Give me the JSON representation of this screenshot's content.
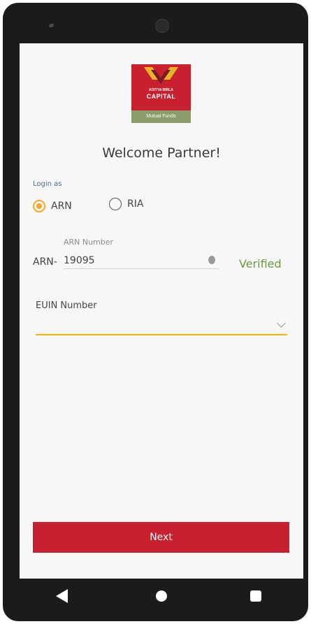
{
  "logo": {
    "line1": "ADITYA BIRLA",
    "line2": "CAPITAL",
    "sub": "Mutual Funds"
  },
  "header": {
    "title": "Welcome Partner!"
  },
  "login": {
    "label": "Login as",
    "options": [
      {
        "label": "ARN",
        "selected": true
      },
      {
        "label": "RIA",
        "selected": false
      }
    ]
  },
  "arn": {
    "field_label": "ARN Number",
    "prefix": "ARN-",
    "value": "19095",
    "status": "Verified"
  },
  "euin": {
    "field_label": "EUIN Number",
    "value": ""
  },
  "actions": {
    "next_label": "Next"
  },
  "colors": {
    "brand_red": "#c8202f",
    "accent_yellow": "#f0b400",
    "verified_green": "#6a9a3a",
    "logo_green": "#8a9d6b"
  }
}
